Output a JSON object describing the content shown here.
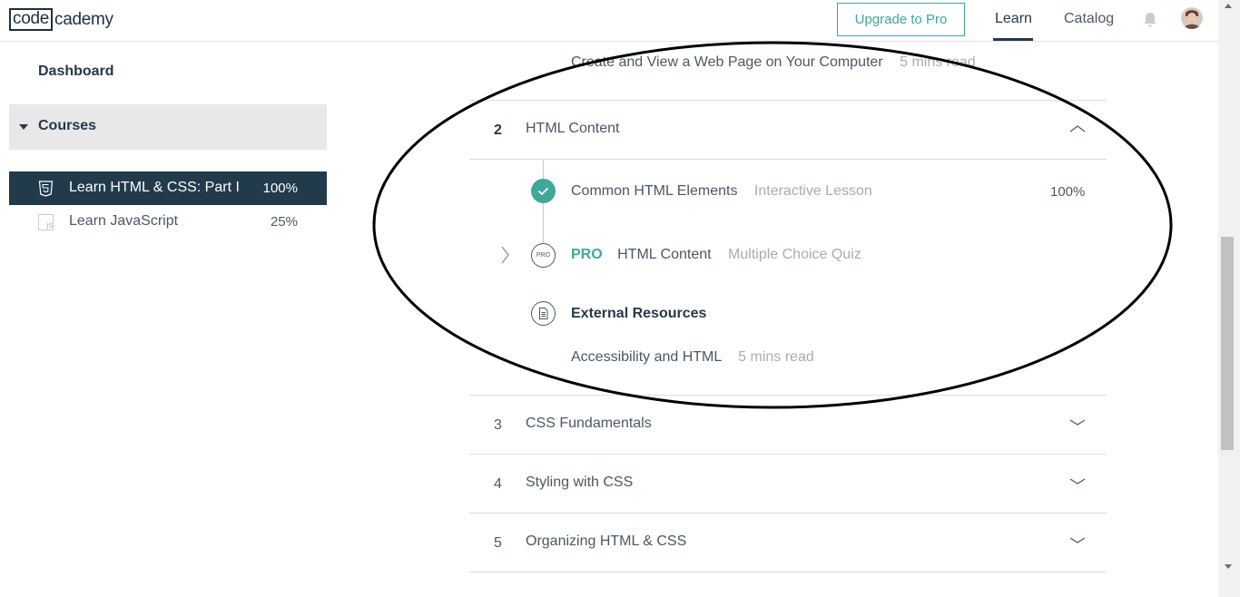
{
  "header": {
    "logo_boxed": "code",
    "logo_rest": "cademy",
    "upgrade_label": "Upgrade to Pro",
    "nav_learn": "Learn",
    "nav_catalog": "Catalog",
    "bell_icon": "bell-icon",
    "avatar_icon": "user-avatar"
  },
  "sidebar": {
    "dashboard": "Dashboard",
    "courses_label": "Courses",
    "courses": [
      {
        "name": "Learn HTML & CSS: Part I",
        "percent": "100%",
        "icon": "html5-icon",
        "active": true
      },
      {
        "name": "Learn JavaScript",
        "percent": "25%",
        "icon": "js-file-icon",
        "active": false
      }
    ]
  },
  "syllabus": {
    "prev_lesson": {
      "title": "Create and View a Web Page on Your Computer",
      "meta": "5 mins read"
    },
    "modules": [
      {
        "number": "2",
        "title": "HTML Content",
        "expanded": true
      },
      {
        "number": "3",
        "title": "CSS Fundamentals",
        "expanded": false
      },
      {
        "number": "4",
        "title": "Styling with CSS",
        "expanded": false
      },
      {
        "number": "5",
        "title": "Organizing HTML & CSS",
        "expanded": false
      }
    ],
    "items": [
      {
        "title": "Common HTML Elements",
        "type": "Interactive Lesson",
        "percent": "100%",
        "status": "complete"
      },
      {
        "pro_badge": "PRO",
        "title": "HTML Content",
        "type": "Multiple Choice Quiz",
        "pro_icon_text": "PRO"
      }
    ],
    "resources": {
      "heading": "External Resources",
      "items": [
        {
          "title": "Accessibility and HTML",
          "meta": "5 mins read"
        }
      ]
    }
  },
  "colors": {
    "accent": "#3ea89b",
    "navy": "#213b4d",
    "text": "#4a5866",
    "muted": "#a7adb3"
  }
}
